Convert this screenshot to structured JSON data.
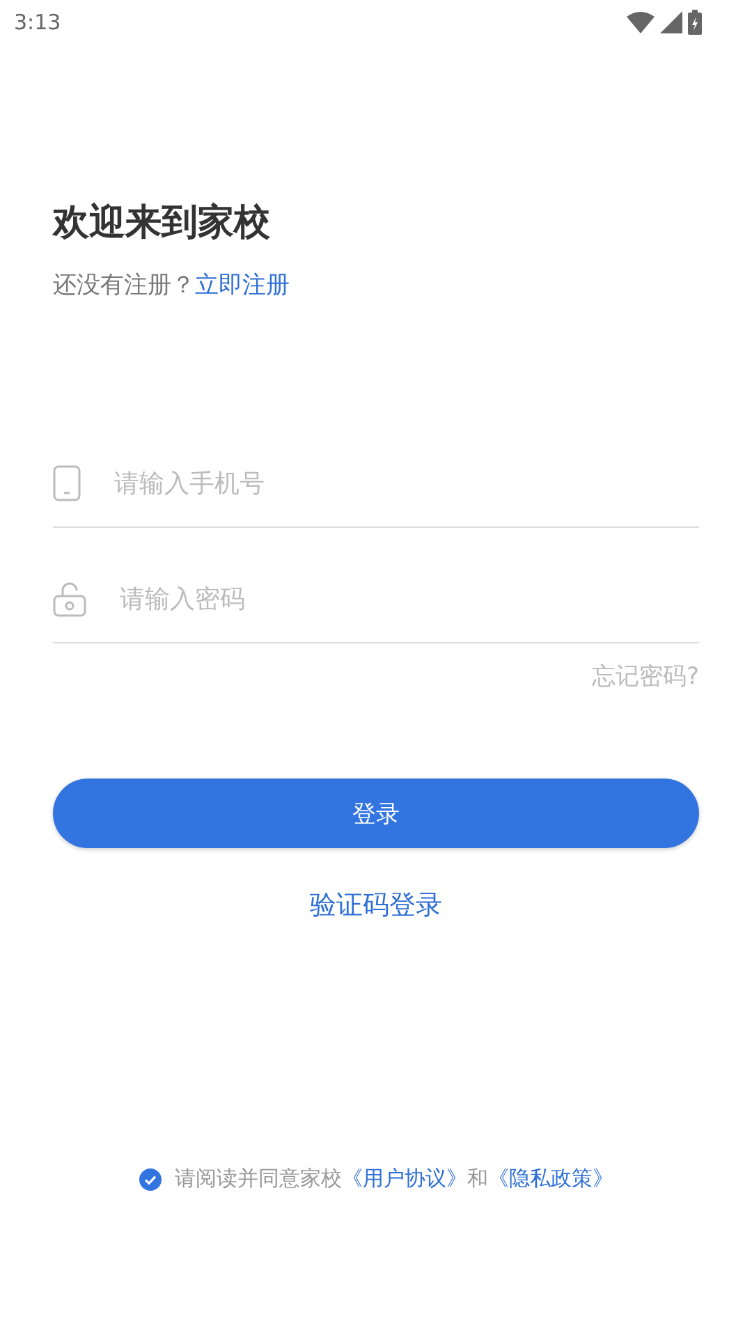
{
  "status_bar": {
    "time": "3:13"
  },
  "title": "欢迎来到家校",
  "register_prompt": {
    "text": "还没有注册？",
    "link": "立即注册"
  },
  "fields": [
    {
      "kind": "phone",
      "placeholder": "请输入手机号"
    },
    {
      "kind": "password",
      "placeholder": "请输入密码"
    }
  ],
  "forgot_password": "忘记密码?",
  "login_button": "登录",
  "sms_login": "验证码登录",
  "agreement": {
    "checked": true,
    "parts": [
      {
        "kind": "text",
        "text": "请阅读并同意家校"
      },
      {
        "kind": "link",
        "text": "《用户协议》"
      },
      {
        "kind": "text",
        "text": "和"
      },
      {
        "kind": "link",
        "text": "《隐私政策》"
      }
    ]
  }
}
